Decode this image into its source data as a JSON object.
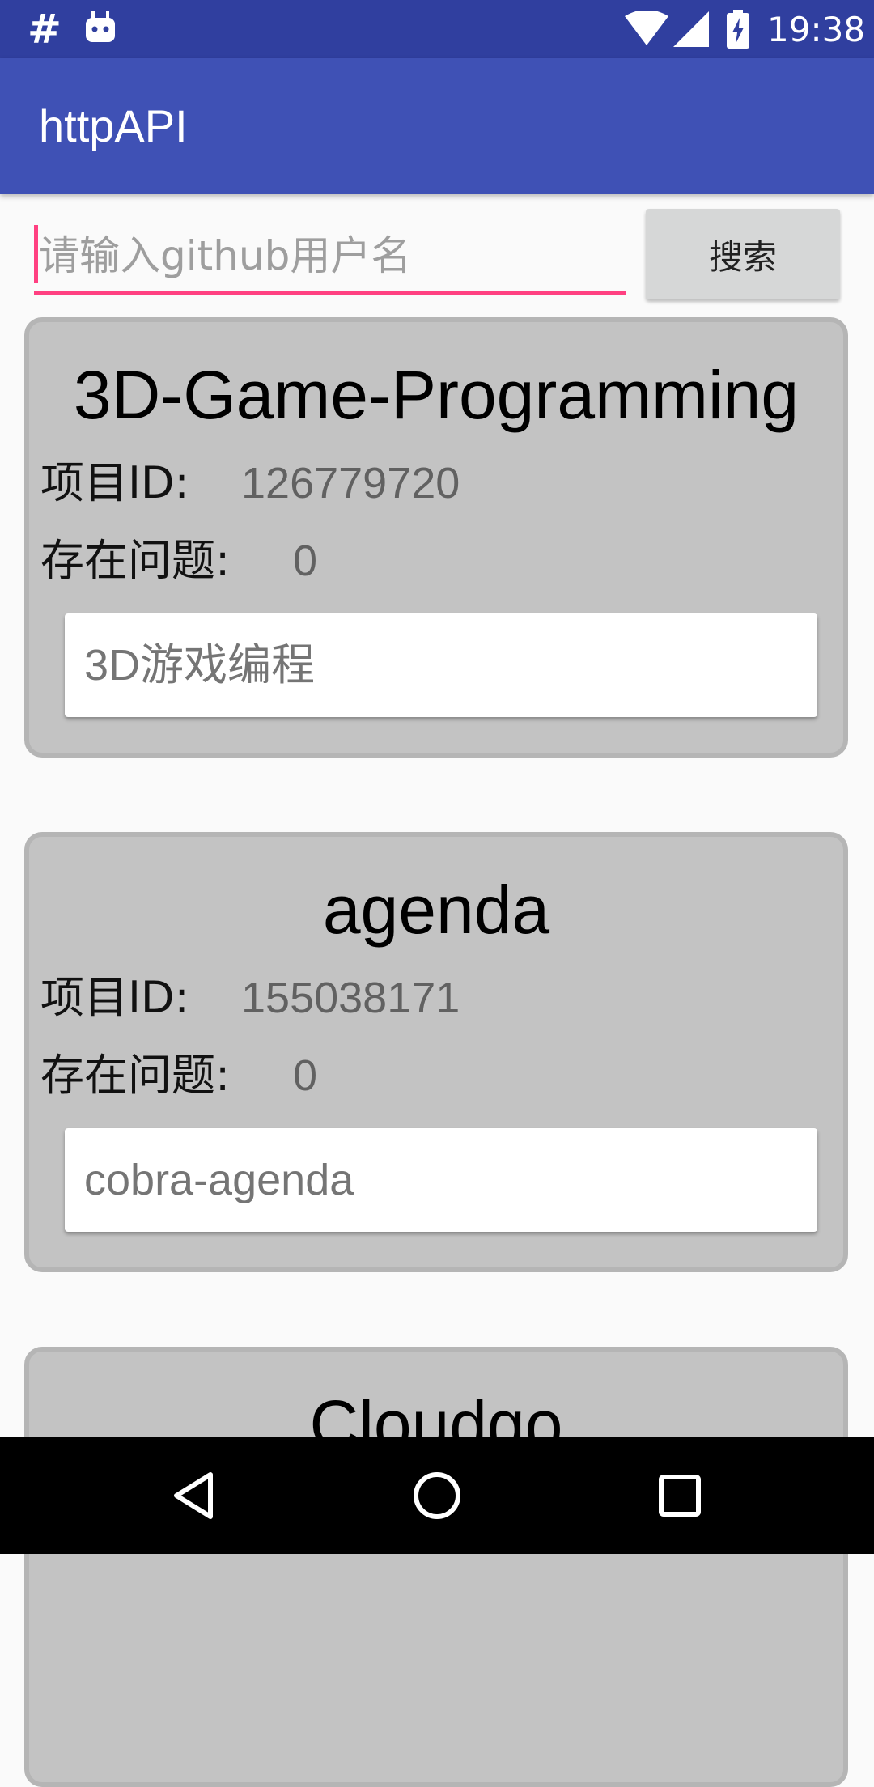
{
  "status_bar": {
    "left_icon_text": "#",
    "time": "19:38"
  },
  "app_bar": {
    "title": "httpAPI"
  },
  "search": {
    "placeholder": "请输入github用户名",
    "value": "",
    "button_label": "搜索"
  },
  "repos": [
    {
      "name": "3D-Game-Programming",
      "id_label": "项目ID:",
      "id": "126779720",
      "issues_label": "存在问题:",
      "issues": "0",
      "description": "3D游戏编程"
    },
    {
      "name": "agenda",
      "id_label": "项目ID:",
      "id": "155038171",
      "issues_label": "存在问题:",
      "issues": "0",
      "description": "cobra-agenda"
    },
    {
      "name": "Cloudgo"
    }
  ],
  "colors": {
    "status_bar": "#303f9f",
    "app_bar": "#3f51b5",
    "accent": "#ff4081",
    "card": "#c3c3c3"
  }
}
